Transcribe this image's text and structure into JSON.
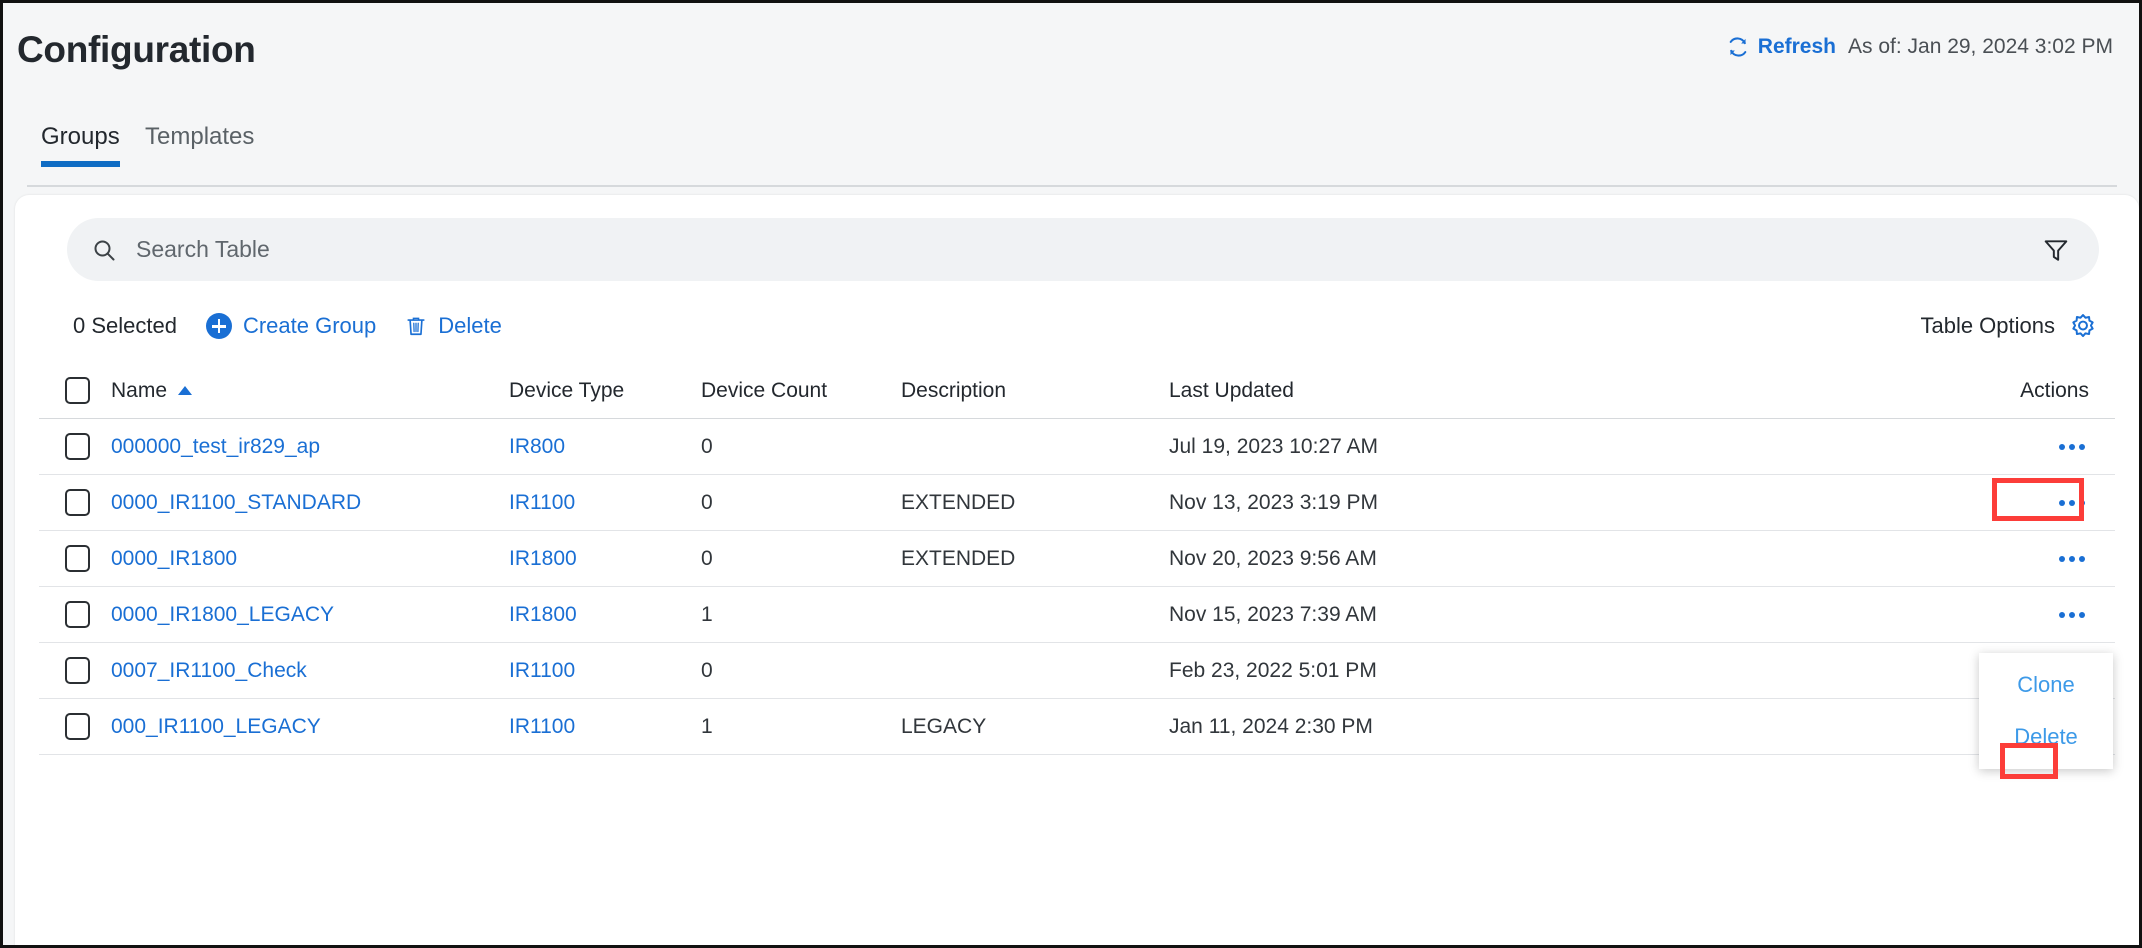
{
  "header": {
    "title": "Configuration",
    "refresh_label": "Refresh",
    "refresh_icon": "refresh-icon",
    "as_of": "As of: Jan 29, 2024 3:02 PM"
  },
  "tabs": [
    {
      "label": "Groups",
      "active": true
    },
    {
      "label": "Templates",
      "active": false
    }
  ],
  "search": {
    "placeholder": "Search Table",
    "value": "",
    "search_icon": "search-icon",
    "filter_icon": "filter-icon"
  },
  "toolbar": {
    "selected_count": "0 Selected",
    "create_group_label": "Create Group",
    "create_group_icon": "plus-circle-icon",
    "delete_label": "Delete",
    "delete_icon": "trash-icon",
    "table_options_label": "Table Options",
    "table_options_icon": "gear-icon"
  },
  "table": {
    "columns": [
      {
        "key": "name",
        "label": "Name",
        "sort": "asc"
      },
      {
        "key": "device_type",
        "label": "Device Type"
      },
      {
        "key": "device_count",
        "label": "Device Count"
      },
      {
        "key": "description",
        "label": "Description"
      },
      {
        "key": "last_updated",
        "label": "Last Updated"
      },
      {
        "key": "actions",
        "label": "Actions"
      }
    ],
    "rows": [
      {
        "name": "000000_test_ir829_ap",
        "device_type": "IR800",
        "device_count": "0",
        "description": "",
        "last_updated": "Jul 19, 2023 10:27 AM"
      },
      {
        "name": "0000_IR1100_STANDARD",
        "device_type": "IR1100",
        "device_count": "0",
        "description": "EXTENDED",
        "last_updated": "Nov 13, 2023 3:19 PM"
      },
      {
        "name": "0000_IR1800",
        "device_type": "IR1800",
        "device_count": "0",
        "description": "EXTENDED",
        "last_updated": "Nov 20, 2023 9:56 AM"
      },
      {
        "name": "0000_IR1800_LEGACY",
        "device_type": "IR1800",
        "device_count": "1",
        "description": "",
        "last_updated": "Nov 15, 2023 7:39 AM"
      },
      {
        "name": "0007_IR1100_Check",
        "device_type": "IR1100",
        "device_count": "0",
        "description": "",
        "last_updated": "Feb 23, 2022 5:01 PM"
      },
      {
        "name": "000_IR1100_LEGACY",
        "device_type": "IR1100",
        "device_count": "1",
        "description": "LEGACY",
        "last_updated": "Jan 11, 2024 2:30 PM"
      }
    ]
  },
  "row_menu": {
    "clone_label": "Clone",
    "delete_label": "Delete"
  },
  "colors": {
    "accent_blue": "#1a6fd4",
    "link_blue": "#3d9ae8",
    "highlight_red": "#fc3d39",
    "page_bg": "#f5f6f7",
    "card_bg": "#ffffff",
    "search_bg": "#f0f2f4",
    "text_dark": "#23282e"
  }
}
